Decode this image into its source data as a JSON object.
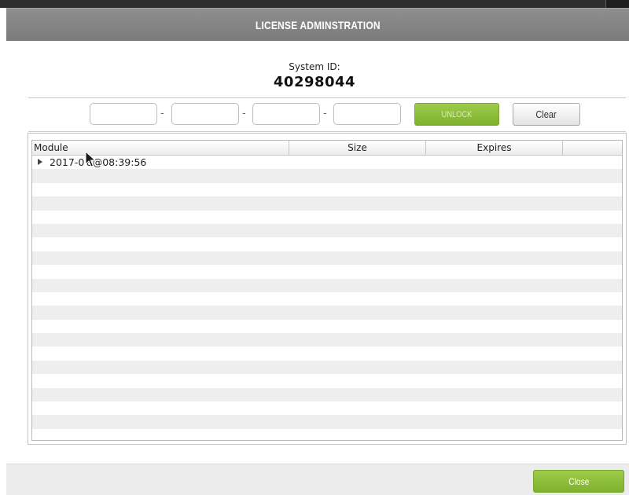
{
  "window": {
    "title": "LICENSE ADMINSTRATION"
  },
  "system": {
    "label": "System ID:",
    "id": "40298044"
  },
  "key_entry": {
    "fields": [
      "",
      "",
      "",
      ""
    ],
    "separator": "-",
    "unlock_label": "UNLOCK",
    "clear_label": "Clear"
  },
  "table": {
    "columns": [
      "Module",
      "Size",
      "Expires",
      ""
    ],
    "rows": [
      {
        "label": "2017-0 8@08:39:56",
        "expanded": false
      }
    ]
  },
  "footer": {
    "close_label": "Close"
  },
  "colors": {
    "accent_green": "#8cbf3f",
    "titlebar": "#858585"
  }
}
